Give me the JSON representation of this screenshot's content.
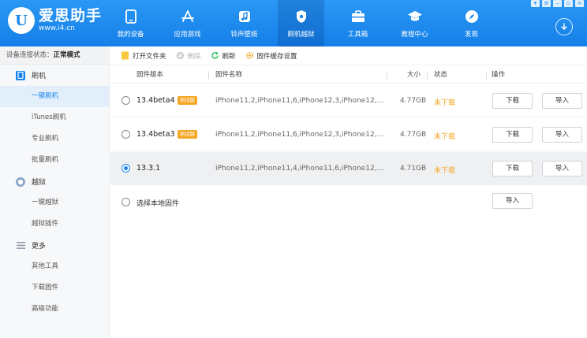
{
  "app": {
    "title": "爱思助手",
    "url": "www.i4.cn",
    "logo_glyph": "U"
  },
  "nav": [
    {
      "label": "我的设备",
      "icon": "phone-icon"
    },
    {
      "label": "应用游戏",
      "icon": "app-store-icon"
    },
    {
      "label": "铃声壁纸",
      "icon": "music-icon"
    },
    {
      "label": "刷机越狱",
      "icon": "shield-icon",
      "active": true
    },
    {
      "label": "工具箱",
      "icon": "toolbox-icon"
    },
    {
      "label": "教程中心",
      "icon": "graduation-cap-icon"
    },
    {
      "label": "发现",
      "icon": "compass-icon"
    }
  ],
  "sidebar": {
    "status_label": "设备连接状态：",
    "status_value": "正常模式",
    "groups": [
      {
        "label": "刷机",
        "icon": "flash-icon",
        "items": [
          "一键刷机",
          "iTunes刷机",
          "专业刷机",
          "批量刷机"
        ]
      },
      {
        "label": "越狱",
        "icon": "jailbreak-icon",
        "items": [
          "一键越狱",
          "越狱插件"
        ]
      },
      {
        "label": "更多",
        "icon": "menu-icon",
        "items": [
          "其他工具",
          "下载固件",
          "高级功能"
        ]
      }
    ],
    "active_item": "一键刷机"
  },
  "toolbar": {
    "open_folder": "打开文件夹",
    "delete": "删除",
    "refresh": "刷新",
    "cache_settings": "固件缓存设置"
  },
  "table": {
    "columns": {
      "version": "固件版本",
      "name": "固件名称",
      "size": "大小",
      "status": "状态",
      "action": "操作"
    },
    "rows": [
      {
        "version": "13.4beta4",
        "tag": "测试版",
        "name": "iPhone11,2,iPhone11,6,iPhone12,3,iPhone12,...",
        "size": "4.77GB",
        "status": "未下载",
        "download": "下载",
        "import": "导入",
        "checked": false
      },
      {
        "version": "13.4beta3",
        "tag": "测试版",
        "name": "iPhone11,2,iPhone11,6,iPhone12,3,iPhone12,...",
        "size": "4.77GB",
        "status": "未下载",
        "download": "下载",
        "import": "导入",
        "checked": false
      },
      {
        "version": "13.3.1",
        "tag": "",
        "name": "iPhone11,2,iPhone11,4,iPhone11,6,iPhone12,...",
        "size": "4.71GB",
        "status": "未下载",
        "download": "下载",
        "import": "导入",
        "checked": true
      }
    ],
    "local": {
      "label": "选择本地固件",
      "import": "导入"
    }
  },
  "colors": {
    "brand": "#1a86ee",
    "warning": "#f5a623"
  }
}
